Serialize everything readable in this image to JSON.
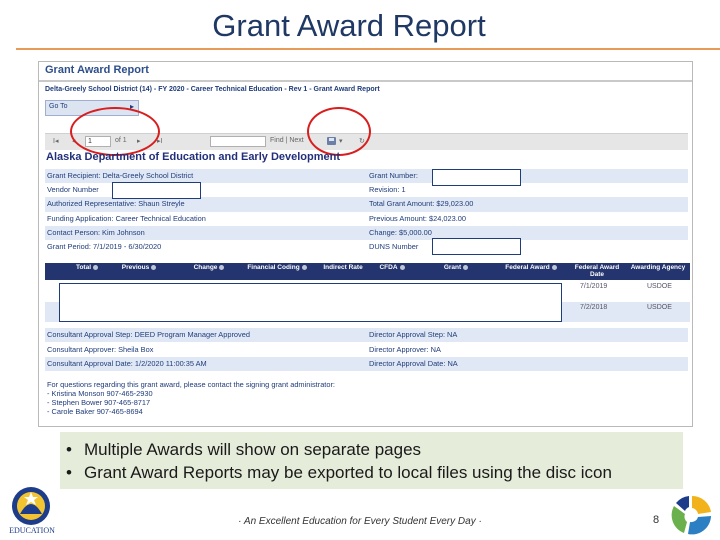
{
  "slide": {
    "title": "Grant Award Report",
    "bullets": [
      "Multiple Awards will show on separate pages",
      "Grant Award Reports may be exported to local files using the disc icon"
    ],
    "footer": "· An Excellent Education for Every Student Every Day ·",
    "page_number": "8",
    "logo_text": "EDUCATION"
  },
  "report": {
    "header": "Grant Award Report",
    "breadcrumb": "Delta-Greely School District (14) - FY 2020 - Career Technical Education - Rev 1 - Grant Award Report",
    "goto_label": "Go To",
    "toolbar": {
      "first": "I◂",
      "prev": "◂",
      "page_value": "1",
      "of_label": "of 1",
      "next": "▸",
      "last": "▸I",
      "find_label": "Find | Next",
      "refresh": "↻"
    },
    "organization": "Alaska Department of Education and Early Development",
    "fields": [
      {
        "left": "Grant Recipient: Delta-Greely School District",
        "right": "Grant Number:"
      },
      {
        "left": "Vendor Number",
        "right": "Revision: 1"
      },
      {
        "left": "Authorized Representative: Shaun Streyle",
        "right": "Total Grant Amount: $29,023.00"
      },
      {
        "left": "Funding Application: Career Technical Education",
        "right": "Previous Amount: $24,023.00"
      },
      {
        "left": "Contact Person: Kim Johnson",
        "right": "Change: $5,000.00"
      },
      {
        "left": "Grant Period: 7/1/2019 - 6/30/2020",
        "right": "DUNS Number"
      }
    ],
    "table_headers": [
      "Total",
      "Previous",
      "Change",
      "Financial Coding",
      "Indirect Rate",
      "CFDA",
      "Grant",
      "Federal Award",
      "Federal Award Date",
      "Awarding Agency"
    ],
    "table_rows": [
      {
        "date": "7/1/2019",
        "agency": "USDOE"
      },
      {
        "date": "7/2/2018",
        "agency": "USDOE"
      }
    ],
    "approvals": [
      {
        "left": "Consultant Approval Step: DEED Program Manager Approved",
        "right": "Director Approval Step: NA"
      },
      {
        "left": "Consultant Approver: Sheila Box",
        "right": "Director Approver: NA"
      },
      {
        "left": "Consultant Approval Date: 1/2/2020 11:00:35 AM",
        "right": "Director Approval Date: NA"
      }
    ],
    "contact_intro": "For questions regarding this grant award, please contact the signing grant administrator:",
    "contacts": [
      "- Kristina Monson 907-465-2930",
      "- Stephen Bower 907-465-8717",
      "- Carole Baker 907-465-8694"
    ]
  },
  "colors": {
    "title": "#1f3864",
    "rule": "#e89a58",
    "report_blue": "#1f3c7a",
    "table_header": "#24346e",
    "annotation_red": "#d81e1e",
    "bullet_bg": "#e5ecd9"
  }
}
